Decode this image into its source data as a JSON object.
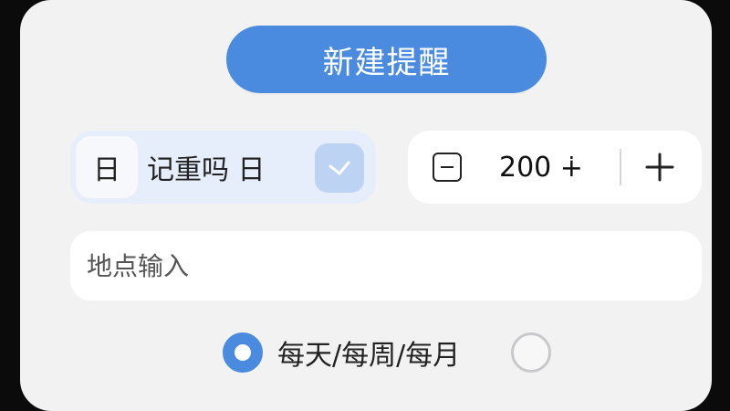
{
  "primary_button": {
    "label": "新建提醒"
  },
  "reminder_type": {
    "day_badge": "日",
    "label": "记重吗 日",
    "check_icon": "check-icon"
  },
  "stepper": {
    "value": "200 ∔",
    "minus_icon": "minus-square-icon",
    "plus_icon": "plus-icon"
  },
  "location": {
    "placeholder": "地点输入",
    "value": ""
  },
  "frequency": {
    "label": "每天/每周/每月",
    "left_radio_selected": true,
    "right_radio_selected": false
  },
  "colors": {
    "accent": "#4a8be0",
    "background": "#f2f2f3",
    "pill_tint": "#e6eefb"
  }
}
